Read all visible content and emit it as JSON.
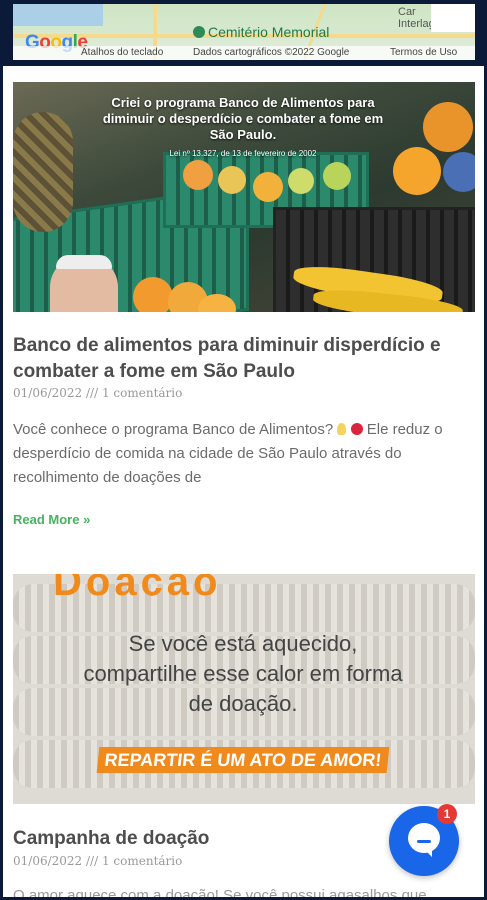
{
  "map": {
    "cemetery_label": "Cemitério Memorial",
    "city_label_1": "Car",
    "city_label_2": "Interlagos",
    "google_logo": [
      "G",
      "o",
      "o",
      "g",
      "l",
      "e"
    ],
    "footer": {
      "shortcuts": "Atalhos do teclado",
      "data": "Dados cartográficos ©2022 Google",
      "terms": "Termos de Uso"
    }
  },
  "posts": [
    {
      "image": {
        "headline": "Criei o programa Banco de Alimentos para diminuir o desperdício e combater a fome em São Paulo.",
        "law": "Lei nº 13.327, de 13 de fevereiro de 2002"
      },
      "title": "Banco de alimentos para diminuir disperdício e combater a fome em São Paulo",
      "date": "01/06/2022",
      "sep": "///",
      "comments": "1 comentário",
      "excerpt_part1": "Você conhece o programa Banco de Alimentos?",
      "excerpt_part2": "Ele reduz o desperdício de comida na cidade de São Paulo através do recolhimento de doações de",
      "read_more": "Read More »",
      "emoji_icons": [
        "light-bulb-icon",
        "red-apple-icon"
      ]
    },
    {
      "image": {
        "top_text": "Doação",
        "main_text": "Se você está aquecido, compartilhe esse calor em forma de doação.",
        "banner": "REPARTIR É UM ATO DE AMOR!"
      },
      "title": "Campanha de doação",
      "date": "01/06/2022",
      "sep": "///",
      "comments": "1 comentário",
      "excerpt_cut": "O amor aquece com a doação! Se você possui agasalhos que"
    }
  ],
  "chat": {
    "badge_count": "1"
  },
  "colors": {
    "accent_green": "#45b45e",
    "chat_blue": "#1a66e8",
    "badge_red": "#e53935",
    "orange": "#f08a1c"
  }
}
